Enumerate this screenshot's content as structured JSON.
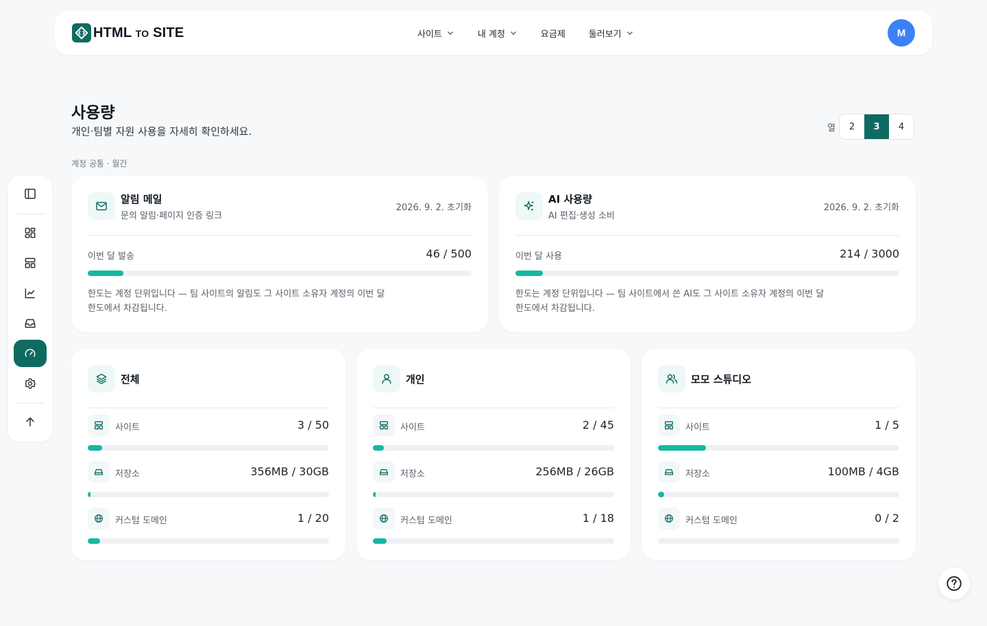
{
  "header": {
    "logo_main": "HTML",
    "logo_small": "TO",
    "logo_end": "SITE",
    "nav": [
      {
        "label": "사이트",
        "dropdown": true
      },
      {
        "label": "내 계정",
        "dropdown": true
      },
      {
        "label": "요금제",
        "dropdown": false
      },
      {
        "label": "둘러보기",
        "dropdown": true
      }
    ],
    "avatar_initial": "M",
    "avatar_color": "#3b82f6"
  },
  "sidebar": {
    "items": [
      {
        "name": "panel-toggle-icon"
      },
      {
        "name": "dashboard-icon"
      },
      {
        "name": "sites-icon"
      },
      {
        "name": "analytics-icon"
      },
      {
        "name": "inbox-icon"
      },
      {
        "name": "usage-gauge-icon",
        "active": true
      },
      {
        "name": "gear-icon"
      },
      {
        "name": "arrow-up-icon"
      }
    ]
  },
  "page": {
    "title": "사용량",
    "subtitle": "개인·팀별 자원 사용을 자세히 확인하세요.",
    "columns_label": "열",
    "columns_options": [
      "2",
      "3",
      "4"
    ],
    "columns_selected": "3",
    "section_label": "계정 공통 · 월간"
  },
  "account_cards": [
    {
      "icon": "mail-icon",
      "title": "알림 메일",
      "subtitle": "문의 알림·페이지 인증 링크",
      "reset": "2026. 9. 2. 초기화",
      "metric_label": "이번 달 발송",
      "metric_value": "46 / 500",
      "fraction": 0.092,
      "note_line1": "한도는 계정 단위입니다 — 팀 사이트의 알림도 그 사이트 소유자 계정의 이번 달",
      "note_line2": "한도에서 차감됩니다."
    },
    {
      "icon": "sparkles-icon",
      "title": "AI 사용량",
      "subtitle": "AI 편집·생성 소비",
      "reset": "2026. 9. 2. 초기화",
      "metric_label": "이번 달 사용",
      "metric_value": "214 / 3000",
      "fraction": 0.0713,
      "note_line1": "한도는 계정 단위입니다 — 팀 사이트에서 쓴 AI도 그 사이트 소유자 계정의 이번 달",
      "note_line2": "한도에서 차감됩니다."
    }
  ],
  "scope_cards": [
    {
      "icon": "layers-icon",
      "title": "전체",
      "rows": [
        {
          "icon": "site-icon",
          "label": "사이트",
          "value": "3 / 50",
          "fraction": 0.06
        },
        {
          "icon": "storage-icon",
          "label": "저장소",
          "value": "356MB / 30GB",
          "fraction": 0.0116
        },
        {
          "icon": "globe-icon",
          "label": "커스텀 도메인",
          "value": "1 / 20",
          "fraction": 0.05
        }
      ]
    },
    {
      "icon": "user-icon",
      "title": "개인",
      "rows": [
        {
          "icon": "site-icon",
          "label": "사이트",
          "value": "2 / 45",
          "fraction": 0.0444
        },
        {
          "icon": "storage-icon",
          "label": "저장소",
          "value": "256MB / 26GB",
          "fraction": 0.0096
        },
        {
          "icon": "globe-icon",
          "label": "커스텀 도메인",
          "value": "1 / 18",
          "fraction": 0.0556
        }
      ]
    },
    {
      "icon": "users-icon",
      "title": "모모 스튜디오",
      "rows": [
        {
          "icon": "site-icon",
          "label": "사이트",
          "value": "1 / 5",
          "fraction": 0.2
        },
        {
          "icon": "storage-icon",
          "label": "저장소",
          "value": "100MB / 4GB",
          "fraction": 0.0244
        },
        {
          "icon": "globe-icon",
          "label": "커스텀 도메인",
          "value": "0 / 2",
          "fraction": 0.0
        }
      ]
    }
  ],
  "colors": {
    "accent": "#0f6b62",
    "bar_fill": "#14b8a0",
    "bar_track": "#eef1f4",
    "background": "#f6f8fa"
  }
}
